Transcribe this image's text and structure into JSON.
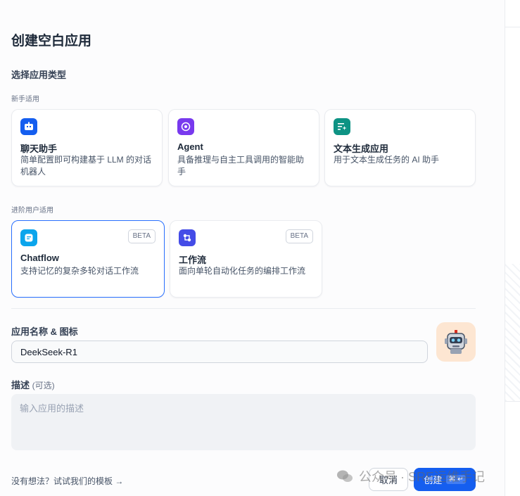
{
  "dialog": {
    "title": "创建空白应用",
    "section_label": "选择应用类型",
    "beginner_label": "新手适用",
    "advanced_label": "进阶用户适用"
  },
  "app_types": {
    "chat": {
      "title": "聊天助手",
      "desc": "简单配置即可构建基于 LLM 的对话机器人",
      "icon": "chat-bot-icon",
      "color": "#155eef"
    },
    "agent": {
      "title": "Agent",
      "desc": "具备推理与自主工具调用的智能助手",
      "icon": "agent-brain-icon",
      "color": "#7839ee"
    },
    "text": {
      "title": "文本生成应用",
      "desc": "用于文本生成任务的 AI 助手",
      "icon": "text-sparkle-icon",
      "color": "#0e9384"
    },
    "chatflow": {
      "title": "Chatflow",
      "desc": "支持记忆的复杂多轮对话工作流",
      "badge": "BETA",
      "icon": "chatflow-icon",
      "color": "#0ba5ec"
    },
    "workflow": {
      "title": "工作流",
      "desc": "面向单轮自动化任务的编排工作流",
      "badge": "BETA",
      "icon": "workflow-icon",
      "color": "#444ce7"
    }
  },
  "form": {
    "name_label": "应用名称 & 图标",
    "name_value": "DeekSeek-R1",
    "avatar_icon": "robot-avatar-icon",
    "desc_label": "描述",
    "desc_optional": "(可选)",
    "desc_placeholder": "输入应用的描述"
  },
  "footer": {
    "template_link": "没有想法？试试我们的模板 →",
    "cancel_label": "取消",
    "create_label": "创建",
    "create_shortcut": "⌘ ↵"
  },
  "watermark": {
    "text": "公众号 · SRE运维手记"
  },
  "colors": {
    "accent": "#155eef",
    "selected_border": "#2970ff"
  }
}
